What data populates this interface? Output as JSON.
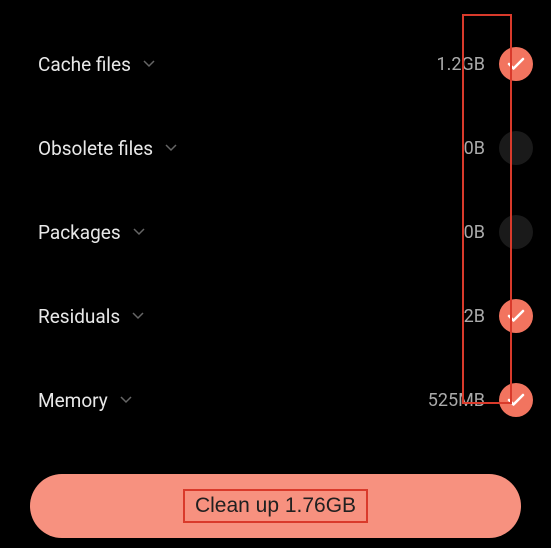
{
  "items": [
    {
      "label": "Cache files",
      "size": "1.2GB",
      "checked": true
    },
    {
      "label": "Obsolete files",
      "size": "0B",
      "checked": false
    },
    {
      "label": "Packages",
      "size": "0B",
      "checked": false
    },
    {
      "label": "Residuals",
      "size": "2B",
      "checked": true
    },
    {
      "label": "Memory",
      "size": "525MB",
      "checked": true
    }
  ],
  "cleanup_button": {
    "label": "Clean up 1.76GB"
  }
}
